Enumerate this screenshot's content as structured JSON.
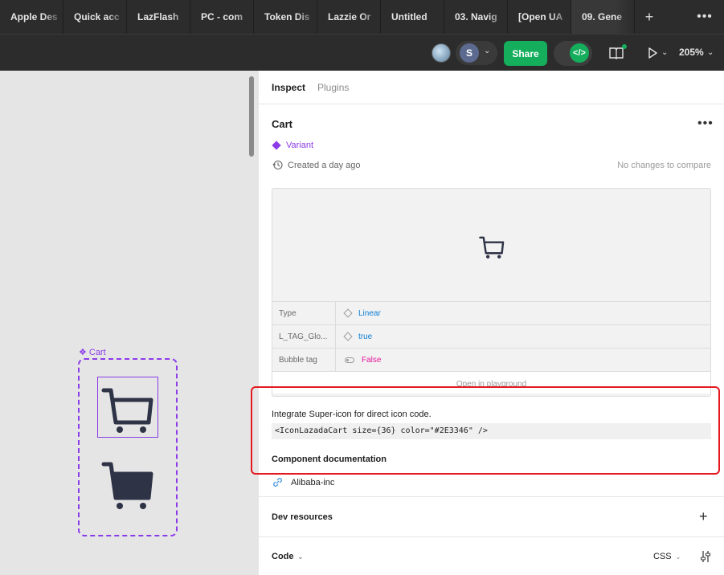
{
  "tabs": [
    "Apple Des",
    "Quick acc",
    "LazFlash",
    "PC - com",
    "Token Dis",
    "Lazzie Or",
    "Untitled",
    "03. Navig",
    "[Open UA",
    "09. Gene"
  ],
  "toolbar": {
    "avatar_initial": "S",
    "share_label": "Share",
    "zoom": "205%"
  },
  "canvas": {
    "component_label": "Cart"
  },
  "panel": {
    "tab_inspect": "Inspect",
    "tab_plugins": "Plugins",
    "component_name": "Cart",
    "variant_label": "Variant",
    "created_text": "Created a day ago",
    "no_changes": "No changes to compare",
    "properties": [
      {
        "name": "Type",
        "value": "Linear",
        "icon": "diamond-icon",
        "color": "#0d7fd4"
      },
      {
        "name": "L_TAG_Glo...",
        "value": "true",
        "icon": "diamond-icon",
        "color": "#0d7fd4"
      },
      {
        "name": "Bubble tag",
        "value": "False",
        "icon": "toggle-icon",
        "color": "#e5179a"
      }
    ],
    "playground": "Open in playground",
    "integrate_text": "Integrate Super-icon for direct icon code.",
    "code_snippet": "<IconLazadaCart size={36} color=\"#2E3346\" />",
    "component_doc_title": "Component documentation",
    "doc_link": "Alibaba-inc",
    "dev_resources": "Dev resources",
    "code_label": "Code",
    "css_label": "CSS"
  },
  "colors": {
    "accent_purple": "#8b3be8",
    "share_green": "#14ae5c",
    "highlight_red": "#e5191f",
    "icon_color": "#2E3346"
  }
}
